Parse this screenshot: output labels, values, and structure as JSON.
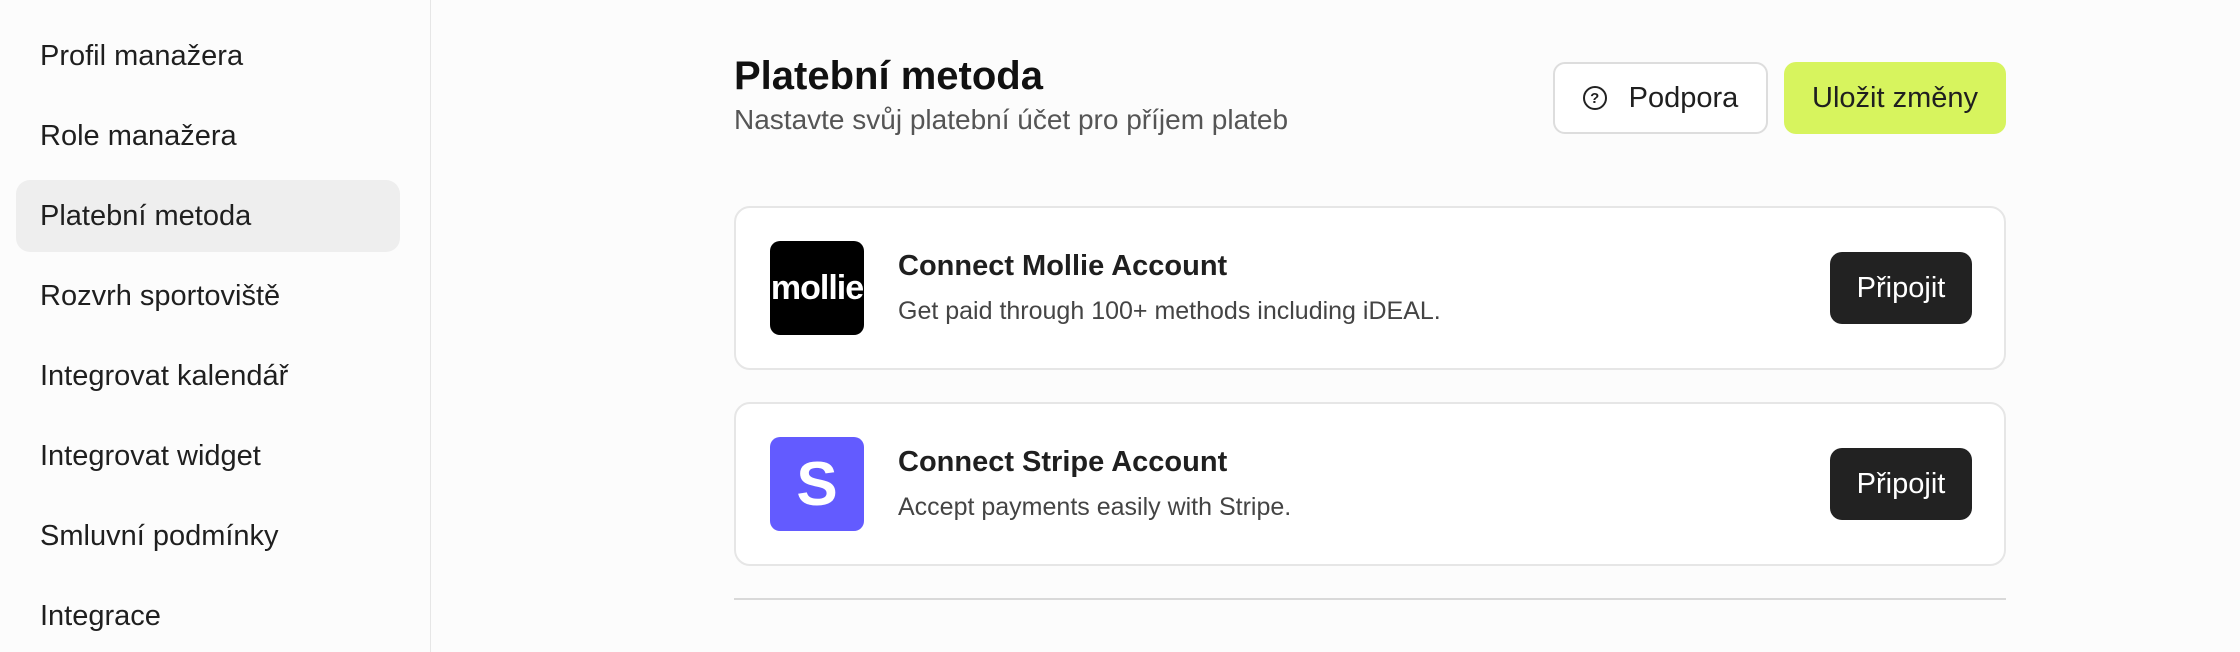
{
  "sidebar": {
    "items": [
      {
        "label": "Profil manažera",
        "active": false
      },
      {
        "label": "Role manažera",
        "active": false
      },
      {
        "label": "Platební metoda",
        "active": true
      },
      {
        "label": "Rozvrh sportoviště",
        "active": false
      },
      {
        "label": "Integrovat kalendář",
        "active": false
      },
      {
        "label": "Integrovat widget",
        "active": false
      },
      {
        "label": "Smluvní podmínky",
        "active": false
      },
      {
        "label": "Integrace",
        "active": false
      }
    ]
  },
  "header": {
    "title": "Platební metoda",
    "subtitle": "Nastavte svůj platební účet pro příjem plateb",
    "support_label": "Podpora",
    "save_label": "Uložit změny"
  },
  "providers": [
    {
      "logo_text": "mollie",
      "title": "Connect Mollie Account",
      "description": "Get paid through 100+ methods including iDEAL.",
      "button_label": "Připojit"
    },
    {
      "logo_text": "S",
      "title": "Connect Stripe Account",
      "description": "Accept payments easily with Stripe.",
      "button_label": "Připojit"
    }
  ],
  "colors": {
    "accent": "#d7f45e",
    "dark_button": "#222222",
    "stripe": "#635bff",
    "mollie": "#000000"
  }
}
